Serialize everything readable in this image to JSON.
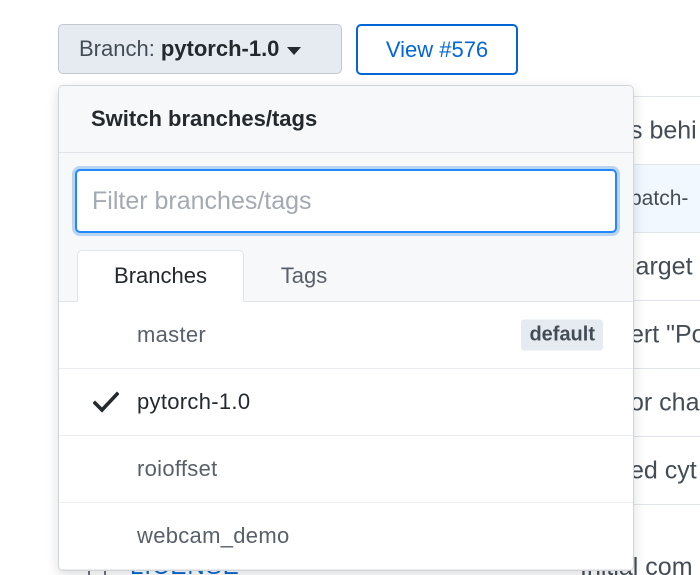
{
  "toolbar": {
    "branch_prefix": "Branch:",
    "branch_name": "pytorch-1.0",
    "view_button": "View #576"
  },
  "dropdown": {
    "header": "Switch branches/tags",
    "filter_placeholder": "Filter branches/tags",
    "filter_value": "",
    "tabs": [
      {
        "label": "Branches",
        "active": true
      },
      {
        "label": "Tags",
        "active": false
      }
    ],
    "branches": [
      {
        "name": "master",
        "badge": "default",
        "selected": false
      },
      {
        "name": "pytorch-1.0",
        "badge": null,
        "selected": true
      },
      {
        "name": "roioffset",
        "badge": null,
        "selected": false
      },
      {
        "name": "webcam_demo",
        "badge": null,
        "selected": false
      }
    ]
  },
  "background": {
    "row_messages": [
      "s behi",
      "patch-",
      "larget",
      "ert \"Po",
      "or cha",
      "ed cyt"
    ],
    "partial_file": "LICENSE",
    "partial_message": "Initial com"
  },
  "colors": {
    "accent": "#0366d6",
    "focus": "#2188ff",
    "header_bg": "#f6f8fa",
    "button_bg": "#e6ebf1"
  }
}
